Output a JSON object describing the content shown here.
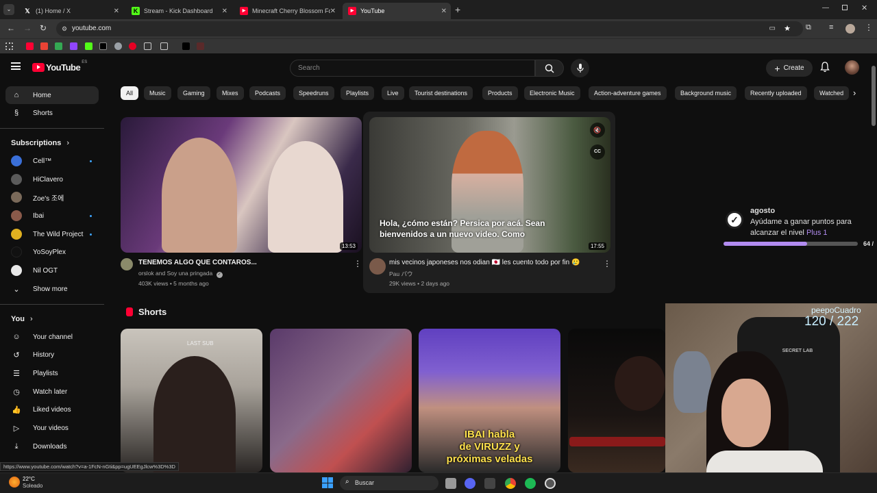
{
  "browser": {
    "tabs": [
      {
        "label": "(1) Home / X",
        "icon": "x-logo-icon"
      },
      {
        "label": "Stream - Kick Dashboard",
        "icon": "kick-icon"
      },
      {
        "label": "Minecraft Cherry Blossom Fore",
        "icon": "youtube-icon"
      },
      {
        "label": "YouTube",
        "icon": "youtube-icon"
      }
    ],
    "url": "youtube.com",
    "status_url": "https://www.youtube.com/watch?v=a-1FcN-nGti&pp=ugUEEgJlcw%3D%3D"
  },
  "youtube": {
    "logo_text": "YouTube",
    "logo_region": "ES",
    "search_placeholder": "Search",
    "create_label": "Create",
    "nav": [
      {
        "label": "Home",
        "icon": "home-icon"
      },
      {
        "label": "Shorts",
        "icon": "shorts-icon"
      }
    ],
    "subscriptions_title": "Subscriptions",
    "subscriptions": [
      {
        "name": "Cell™",
        "color": "#3a6fd8",
        "new": true
      },
      {
        "name": "HiClavero",
        "color": "#5b5b5b",
        "new": false
      },
      {
        "name": "Zoe's 조에",
        "color": "#7a6a5a",
        "new": false
      },
      {
        "name": "Ibai",
        "color": "#8a5a4a",
        "new": true
      },
      {
        "name": "The Wild Project",
        "color": "#e0b020",
        "new": true
      },
      {
        "name": "YoSoyPlex",
        "color": "#111111",
        "new": false
      },
      {
        "name": "Nil OGT",
        "color": "#e8e8e8",
        "new": false
      }
    ],
    "show_more": "Show more",
    "you_title": "You",
    "you_items": [
      {
        "label": "Your channel",
        "icon": "channel-icon"
      },
      {
        "label": "History",
        "icon": "history-icon"
      },
      {
        "label": "Playlists",
        "icon": "playlists-icon"
      },
      {
        "label": "Watch later",
        "icon": "watch-later-icon"
      },
      {
        "label": "Liked videos",
        "icon": "thumbs-up-icon"
      },
      {
        "label": "Your videos",
        "icon": "your-videos-icon"
      },
      {
        "label": "Downloads",
        "icon": "download-icon"
      }
    ],
    "chips": [
      "All",
      "Music",
      "Gaming",
      "Mixes",
      "Podcasts",
      "Speedruns",
      "Playlists",
      "Live",
      "Tourist destinations",
      "Products",
      "Electronic Music",
      "Action-adventure games",
      "Background music",
      "Recently uploaded",
      "Watched"
    ],
    "videos": [
      {
        "title": "TENEMOS ALGO QUE CONTAROS...",
        "channel": "orslok and Soy una pringada",
        "meta": "403K views • 5 months ago",
        "duration": "13:53"
      },
      {
        "title": "mis vecinos japoneses nos odian 🇯🇵 les cuento todo por fin 🥲",
        "channel": "Pau パウ",
        "meta": "29K views • 2 days ago",
        "duration": "17:55",
        "caption_line1": "Hola, ¿cómo están? Persica por acá. Sean",
        "caption_line2": "bienvenidos a un nuevo video. Como"
      }
    ],
    "shorts_title": "Shorts",
    "shorts": [
      {
        "overlay": "LAST SUB"
      },
      {
        "overlay": ""
      },
      {
        "overlay1": "IBAI habla",
        "overlay2": "de VIRUZZ y",
        "overlay3": "próximas veladas"
      },
      {
        "overlay": ""
      }
    ]
  },
  "overlay_widget": {
    "title": "agosto",
    "line1": "Ayúdame a ganar puntos para",
    "line2_prefix": "alcanzar el nivel ",
    "line2_plus": "Plus 1",
    "progress_text": "64 /",
    "progress": 0.62
  },
  "webcam": {
    "name": "peepoCuadro",
    "count": "120 / 222",
    "chair_text": "SECRET LAB"
  },
  "taskbar": {
    "temp": "22°C",
    "weather": "Soleado",
    "search_placeholder": "Buscar"
  }
}
